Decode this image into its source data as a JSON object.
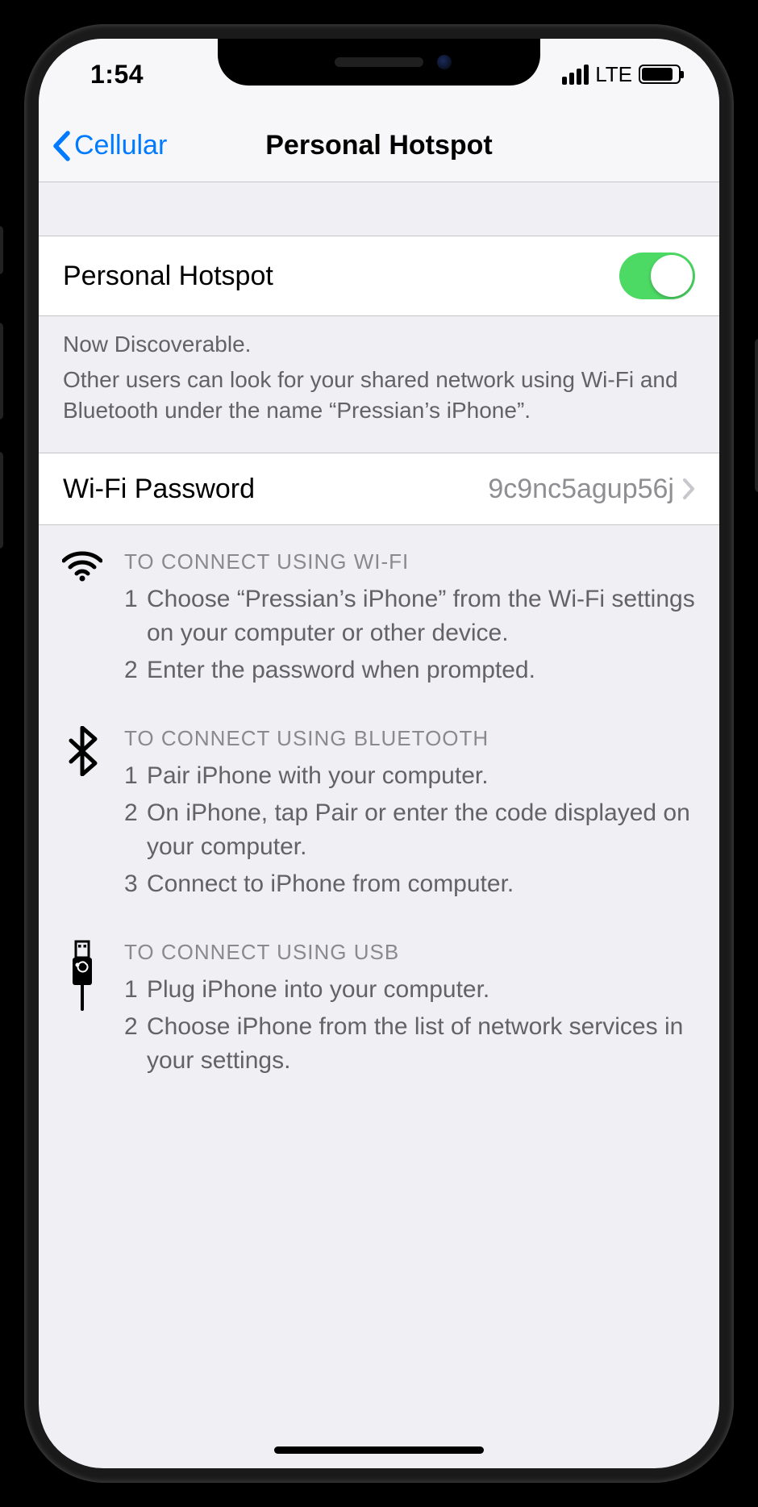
{
  "status": {
    "time": "1:54",
    "network": "LTE"
  },
  "nav": {
    "back": "Cellular",
    "title": "Personal Hotspot"
  },
  "hotspot": {
    "label": "Personal Hotspot",
    "enabled": true,
    "desc_line1": "Now Discoverable.",
    "desc_line2": "Other users can look for your shared network using Wi-Fi and Bluetooth under the name “Pressian’s iPhone”."
  },
  "password": {
    "label": "Wi-Fi Password",
    "value": "9c9nc5agup56j"
  },
  "instructions": {
    "wifi": {
      "heading": "TO CONNECT USING WI-FI",
      "steps": [
        "Choose “Pressian’s iPhone” from the Wi-Fi settings on your computer or other device.",
        "Enter the password when prompted."
      ]
    },
    "bluetooth": {
      "heading": "TO CONNECT USING BLUETOOTH",
      "steps": [
        "Pair iPhone with your computer.",
        "On iPhone, tap Pair or enter the code displayed on your computer.",
        "Connect to iPhone from computer."
      ]
    },
    "usb": {
      "heading": "TO CONNECT USING USB",
      "steps": [
        "Plug iPhone into your computer.",
        "Choose iPhone from the list of network services in your settings."
      ]
    }
  }
}
